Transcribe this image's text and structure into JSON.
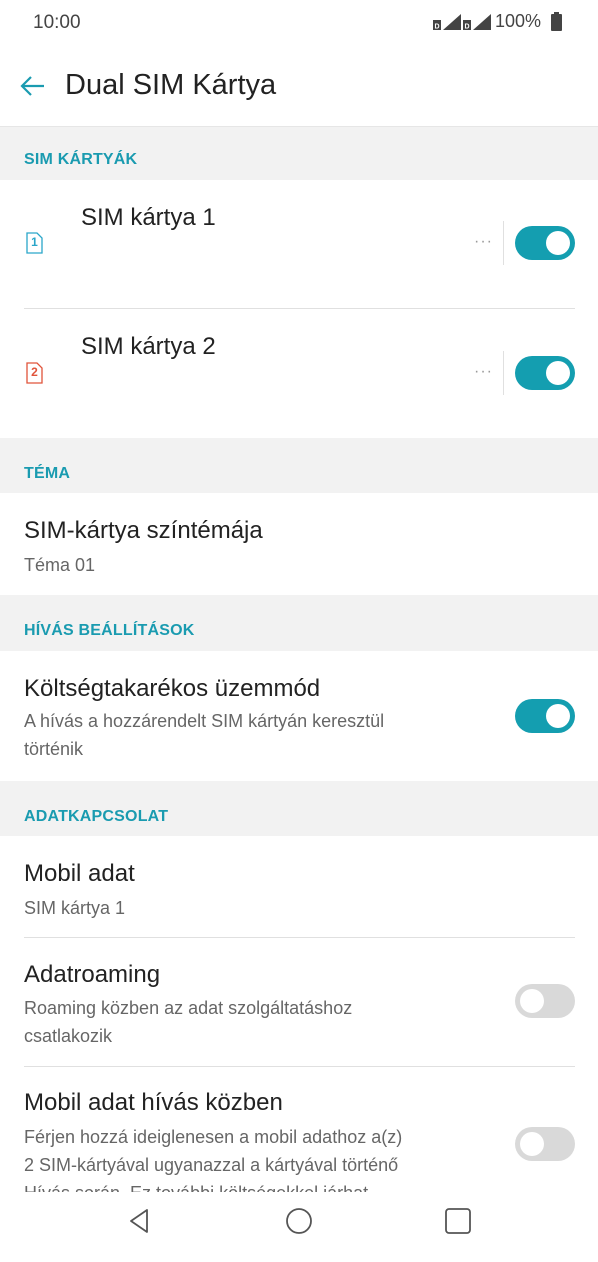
{
  "status": {
    "time": "10:00",
    "battery": "100%"
  },
  "appbar": {
    "title": "Dual SIM Kártya"
  },
  "sections": {
    "sim_cards": "SIM KÁRTYÁK",
    "theme": "TÉMA",
    "call_settings": "HÍVÁS BEÁLLÍTÁSOK",
    "data_connection": "ADATKAPCSOLAT"
  },
  "sim1": {
    "label": "SIM kártya 1",
    "icon_number": "1",
    "enabled": true,
    "icon_color": "#2aa6c9"
  },
  "sim2": {
    "label": "SIM kártya 2",
    "icon_number": "2",
    "enabled": true,
    "icon_color": "#e0533a"
  },
  "more_label": "···",
  "theme_row": {
    "title": "SIM-kártya színtémája",
    "value": "Téma 01"
  },
  "cost_saving": {
    "title": "Költségtakarékos üzemmód",
    "subtitle_line1": "A hívás a hozzárendelt SIM kártyán keresztül",
    "subtitle_line2": "történik",
    "enabled": true
  },
  "mobile_data": {
    "title": "Mobil adat",
    "value": "SIM kártya 1"
  },
  "data_roaming": {
    "title": "Adatroaming",
    "subtitle_line1": "Roaming közben az adat szolgáltatáshoz",
    "subtitle_line2": "csatlakozik",
    "enabled": false
  },
  "data_during_call": {
    "title": "Mobil adat hívás közben",
    "subtitle_line1": "Férjen hozzá ideiglenesen a mobil adathoz a(z)",
    "subtitle_line2": "2 SIM-kártyával ugyanazzal a kártyával történő",
    "subtitle_line3": "Hívás során. Ez további költségekkel járhat",
    "enabled": false
  },
  "colors": {
    "accent": "#149eb0",
    "section_label": "#1a9bb0",
    "section_bg": "#f2f2f2"
  }
}
